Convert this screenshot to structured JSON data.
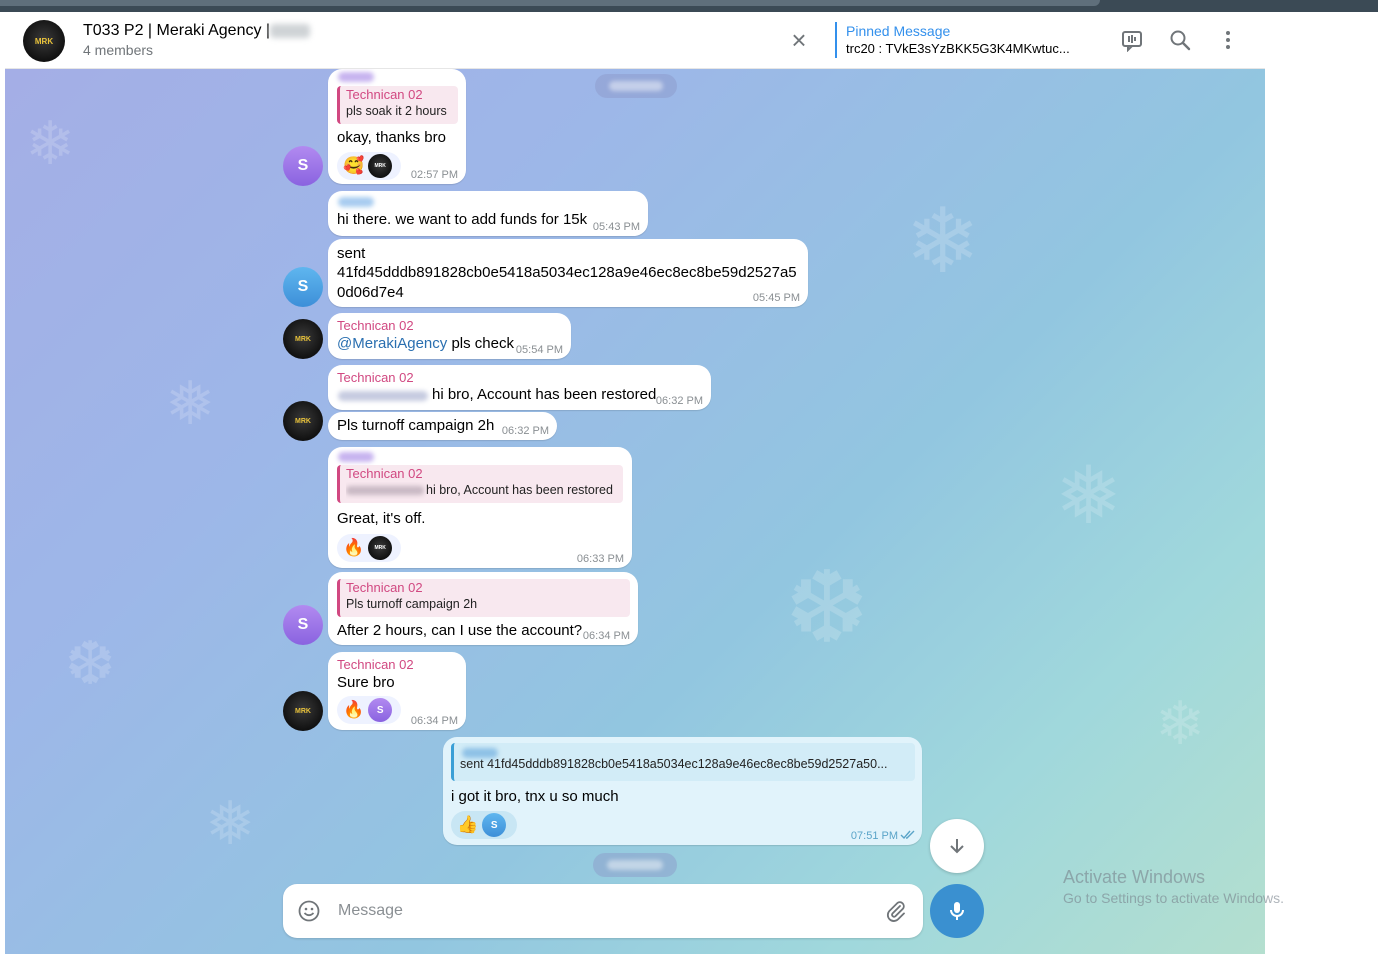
{
  "header": {
    "title": "T033 P2 | Meraki Agency |",
    "subtitle": "4 members",
    "avatar_text": "MRK",
    "pinned_label": "Pinned Message",
    "pinned_text": "trc20 : TVkE3sYzBKK5G3K4MKwtuc..."
  },
  "messages": [
    {
      "reply_name": "Technican 02",
      "reply_text": "pls soak it 2 hours",
      "text": "okay, thanks bro",
      "time": "02:57 PM",
      "reactions": [
        "🥰"
      ],
      "avatar": "S"
    },
    {
      "text": "hi there. we want to add funds for 15k",
      "time": "05:43 PM"
    },
    {
      "text_lines": [
        "sent",
        "41fd45dddb891828cb0e5418a5034ec128a9e46ec8ec8be59d2527a5",
        "0d06d7e4"
      ],
      "time": "05:45 PM",
      "avatar": "S"
    },
    {
      "sender": "Technican 02",
      "mention": "@MerakiAgency",
      "text": " pls check",
      "time": "05:54 PM"
    },
    {
      "sender": "Technican 02",
      "text": "hi bro, Account has been restored",
      "time": "06:32 PM"
    },
    {
      "text": "Pls turnoff campaign 2h",
      "time": "06:32 PM"
    },
    {
      "reply_name": "Technican 02",
      "reply_text": "hi bro, Account has been restored",
      "text": "Great, it's off.",
      "time": "06:33 PM",
      "reactions": [
        "🔥"
      ]
    },
    {
      "reply_name": "Technican 02",
      "reply_text": "Pls turnoff campaign 2h",
      "text": "After 2 hours, can I use the account?",
      "time": "06:34 PM",
      "avatar": "S"
    },
    {
      "sender": "Technican 02",
      "text": "Sure bro",
      "time": "06:34 PM",
      "reactions": [
        "🔥"
      ],
      "reactor": "S"
    },
    {
      "reply_text": "sent 41fd45dddb891828cb0e5418a5034ec128a9e46ec8ec8be59d2527a50...",
      "text": "i got it bro, tnx u so much",
      "time": "07:51 PM",
      "reactions": [
        "👍"
      ],
      "reactor": "S"
    }
  ],
  "composer": {
    "placeholder": "Message"
  },
  "watermark": {
    "line1": "Activate Windows",
    "line2": "Go to Settings to activate Windows."
  },
  "colors": {
    "accent": "#3390ec",
    "sender_name": "#d14881",
    "mic_button": "#3a90d0"
  }
}
